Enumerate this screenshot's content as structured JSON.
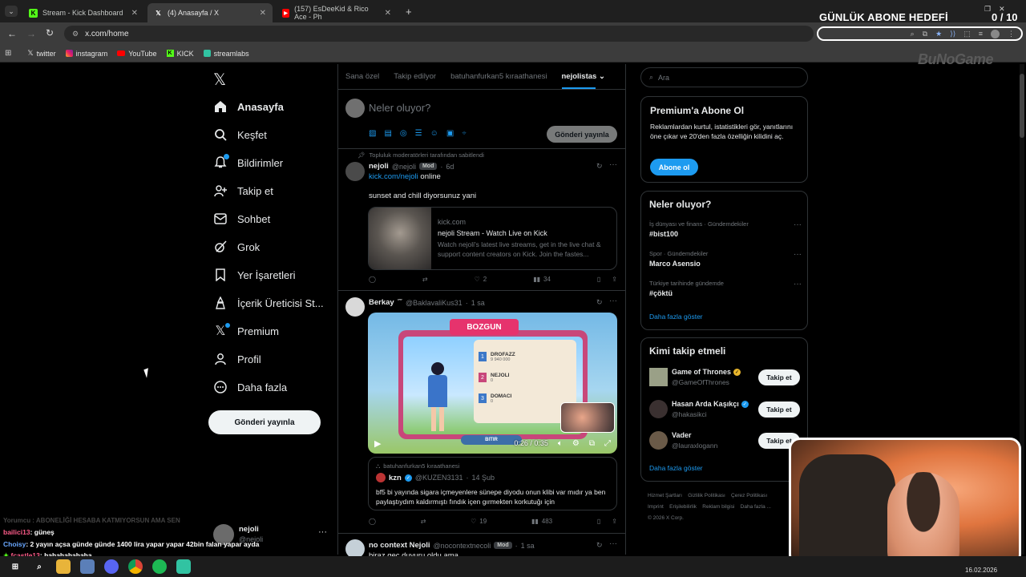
{
  "browser": {
    "tabs": [
      {
        "title": "Stream - Kick Dashboard",
        "fav": "K",
        "favColor": "#53fc18"
      },
      {
        "title": "(4) Anasayfa / X",
        "fav": "X",
        "favColor": "#000000"
      },
      {
        "title": "(157) EsDeeKid & Rico Ace - Ph",
        "fav": "▶",
        "favColor": "#ff0000"
      }
    ],
    "url": "x.com/home",
    "bookmarks": [
      {
        "label": "twitter",
        "icon": "x-icon"
      },
      {
        "label": "instagram",
        "icon": "instagram-icon"
      },
      {
        "label": "YouTube",
        "icon": "youtube-icon"
      },
      {
        "label": "KICK",
        "icon": "kick-icon"
      },
      {
        "label": "streamlabs",
        "icon": "streamlabs-icon"
      }
    ]
  },
  "overlay": {
    "goal_title": "GÜNLÜK ABONE HEDEFİ",
    "goal_count": "0 / 10",
    "goal_progress": 0,
    "brand": "BuNoGame"
  },
  "nav": {
    "items": [
      {
        "label": "Anasayfa",
        "icon": "home-icon",
        "bold": true
      },
      {
        "label": "Keşfet",
        "icon": "search-icon"
      },
      {
        "label": "Bildirimler",
        "icon": "bell-icon"
      },
      {
        "label": "Takip et",
        "icon": "follow-icon"
      },
      {
        "label": "Sohbet",
        "icon": "mail-icon"
      },
      {
        "label": "Grok",
        "icon": "grok-icon"
      },
      {
        "label": "Yer İşaretleri",
        "icon": "bookmark-icon"
      },
      {
        "label": "İçerik Üreticisi St...",
        "icon": "creator-icon"
      },
      {
        "label": "Premium",
        "icon": "x-premium-icon"
      },
      {
        "label": "Profil",
        "icon": "profile-icon"
      },
      {
        "label": "Daha fazla",
        "icon": "more-icon"
      }
    ],
    "post_button": "Gönderi yayınla",
    "account": {
      "name": "nejoli",
      "handle": "@nejoli"
    }
  },
  "timeline": {
    "tabs": [
      "Sana özel",
      "Takip edilyor",
      "batuhanfurkan5 kıraathanesi",
      "nejolistas"
    ],
    "compose_placeholder": "Neler oluyor?",
    "compose_button": "Gönderi yayınla",
    "pinned_label": "Topluluk moderatörleri tarafından sabitlendi",
    "post1": {
      "name": "nejoli",
      "handle": "@nejoli",
      "badge": "Mod",
      "time": "6d",
      "link": "kick.com/nejoli",
      "link_suffix": " online",
      "text": "sunset and chill diyorsunuz yani",
      "card_domain": "kick.com",
      "card_title": "nejoli Stream - Watch Live on Kick",
      "card_desc": "Watch nejoli's latest live streams, get in the live chat & support content creators on Kick. Join the fastes...",
      "replies": "",
      "likes": "2",
      "views": "34"
    },
    "post2": {
      "name": "Berkay",
      "name_suffix": "⁗",
      "handle": "@BaklavaliKus31",
      "time": "1 sa",
      "video_title": "BOZGUN",
      "video_rows": [
        {
          "rank": "1",
          "name": "DROFAZZ",
          "score": "9 940 000"
        },
        {
          "rank": "2",
          "name": "NEJOLI",
          "score": "0"
        },
        {
          "rank": "3",
          "name": "DOMACI",
          "score": "0"
        }
      ],
      "video_time": "0:26 / 0:35",
      "video_button": "BITIR",
      "quote_community": "batuhanfurkan5 kıraathanesi",
      "quote_name": "kzn",
      "quote_handle": "@KUZEN3131",
      "quote_time": "14 Şub",
      "quote_text": "bf5 bi yayında sigara içmeyenlere sünepe diyodu onun klibi var mıdır ya ben paylaştıydım kaldırmıştı fındık içen gırmekten korkutuğı için",
      "likes": "19",
      "views": "483"
    },
    "post3": {
      "name": "no context Nejoli",
      "handle": "@nocontextnecoli",
      "badge": "Mod",
      "time": "1 sa",
      "text": "biraz geç duyuru oldu ama"
    }
  },
  "sidebar": {
    "search_placeholder": "Ara",
    "premium": {
      "title": "Premium'a Abone Ol",
      "text": "Reklamlardan kurtul, istatistikleri gör, yanıtlarını öne çıkar ve 20'den fazla özelliğin kilidini aç.",
      "button": "Abone ol"
    },
    "trends_title": "Neler oluyor?",
    "trends": [
      {
        "meta": "İş dünyası ve finans · Gündemdekiler",
        "name": "#bist100"
      },
      {
        "meta": "Spor · Gündemdekiler",
        "name": "Marco Asensio"
      },
      {
        "meta": "Türkiye tarihinde gündemde",
        "name": "#çöktü"
      }
    ],
    "show_more": "Daha fazla göster",
    "who_title": "Kimi takip etmeli",
    "who": [
      {
        "name": "Game of Thrones",
        "handle": "@GameOfThrones",
        "verified": true,
        "verified_color": "#e8b62c"
      },
      {
        "name": "Hasan Arda Kaşıkçı",
        "handle": "@hakasikci",
        "verified": true,
        "verified_color": "#1d9bf0"
      },
      {
        "name": "Vader",
        "handle": "@lauraxlogann",
        "verified": false,
        "verified_color": ""
      }
    ],
    "follow_label": "Takip et",
    "footer": [
      "Hizmet Şartları",
      "Gizlilik Politikası",
      "Çerez Politikası",
      "Imprint",
      "Erişilebilirlik",
      "Reklam bilgisi",
      "Daha fazla ...",
      "© 2026 X Corp."
    ]
  },
  "chat": {
    "faded": "Yorumcu : ABONELİĞİ HESABA KATMIYORSUN AMA SEN",
    "lines": [
      {
        "user": "bailici13",
        "color": "#ff5c8a",
        "msg": ": güneş"
      },
      {
        "user": "Choisy",
        "color": "#6aa8ff",
        "msg": ": 2 yayın açsa günde günde 1400 lira yapar yapar 42bin falan yapar ayda"
      },
      {
        "user": "fcastle13",
        "color": "#ff5c8a",
        "msg": ": hahahahahaha"
      }
    ]
  },
  "taskbar": {
    "date": "16.02.2026"
  }
}
